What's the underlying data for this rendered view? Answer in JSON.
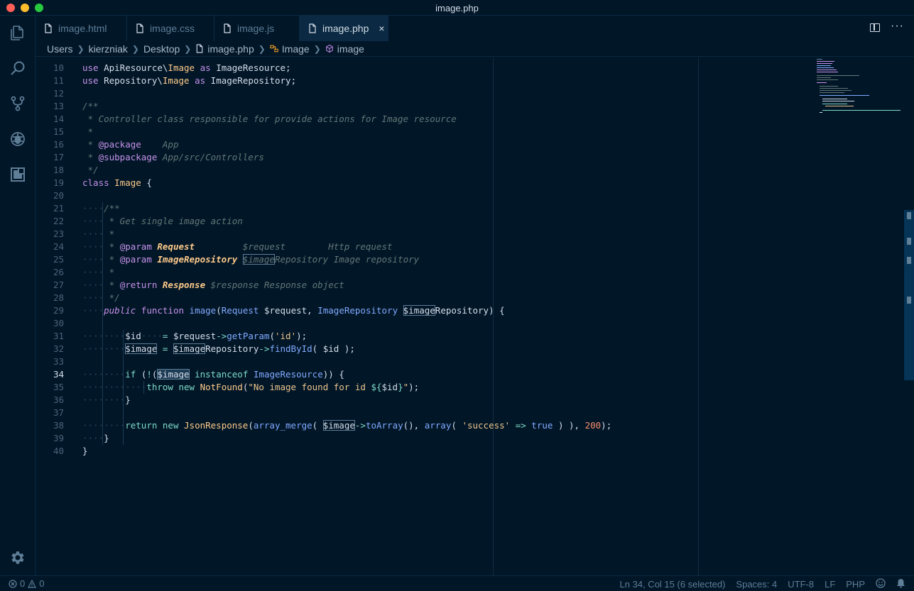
{
  "window": {
    "title": "image.php"
  },
  "tabs": [
    {
      "label": "image.html",
      "active": false
    },
    {
      "label": "image.css",
      "active": false
    },
    {
      "label": "image.js",
      "active": false
    },
    {
      "label": "image.php",
      "active": true,
      "close": "×"
    }
  ],
  "breadcrumbs": [
    "Users",
    "kierzniak",
    "Desktop",
    "image.php",
    "Image",
    "image"
  ],
  "editor": {
    "line_numbers": [
      "10",
      "11",
      "12",
      "13",
      "14",
      "15",
      "16",
      "17",
      "18",
      "19",
      "20",
      "21",
      "22",
      "23",
      "24",
      "25",
      "26",
      "27",
      "28",
      "29",
      "30",
      "31",
      "32",
      "33",
      "34",
      "35",
      "36",
      "37",
      "38",
      "39",
      "40"
    ],
    "current_line": "34"
  },
  "tab_actions": {
    "more": "···"
  },
  "status": {
    "errors": "0",
    "warnings": "0",
    "position": "Ln 34, Col 15 (6 selected)",
    "spaces": "Spaces: 4",
    "encoding": "UTF-8",
    "eol": "LF",
    "language": "PHP"
  },
  "colors": {
    "background": "#011627",
    "keyword": "#c792ea",
    "class": "#ffcb8b",
    "function": "#82aaff",
    "string": "#ecc48d",
    "number": "#f78c6c",
    "comment": "#637777",
    "operator": "#7fdbca"
  },
  "icons": {
    "activity_bar": [
      "files-icon",
      "search-icon",
      "source-control-icon",
      "debug-icon",
      "extensions-icon",
      "gear-icon"
    ]
  }
}
